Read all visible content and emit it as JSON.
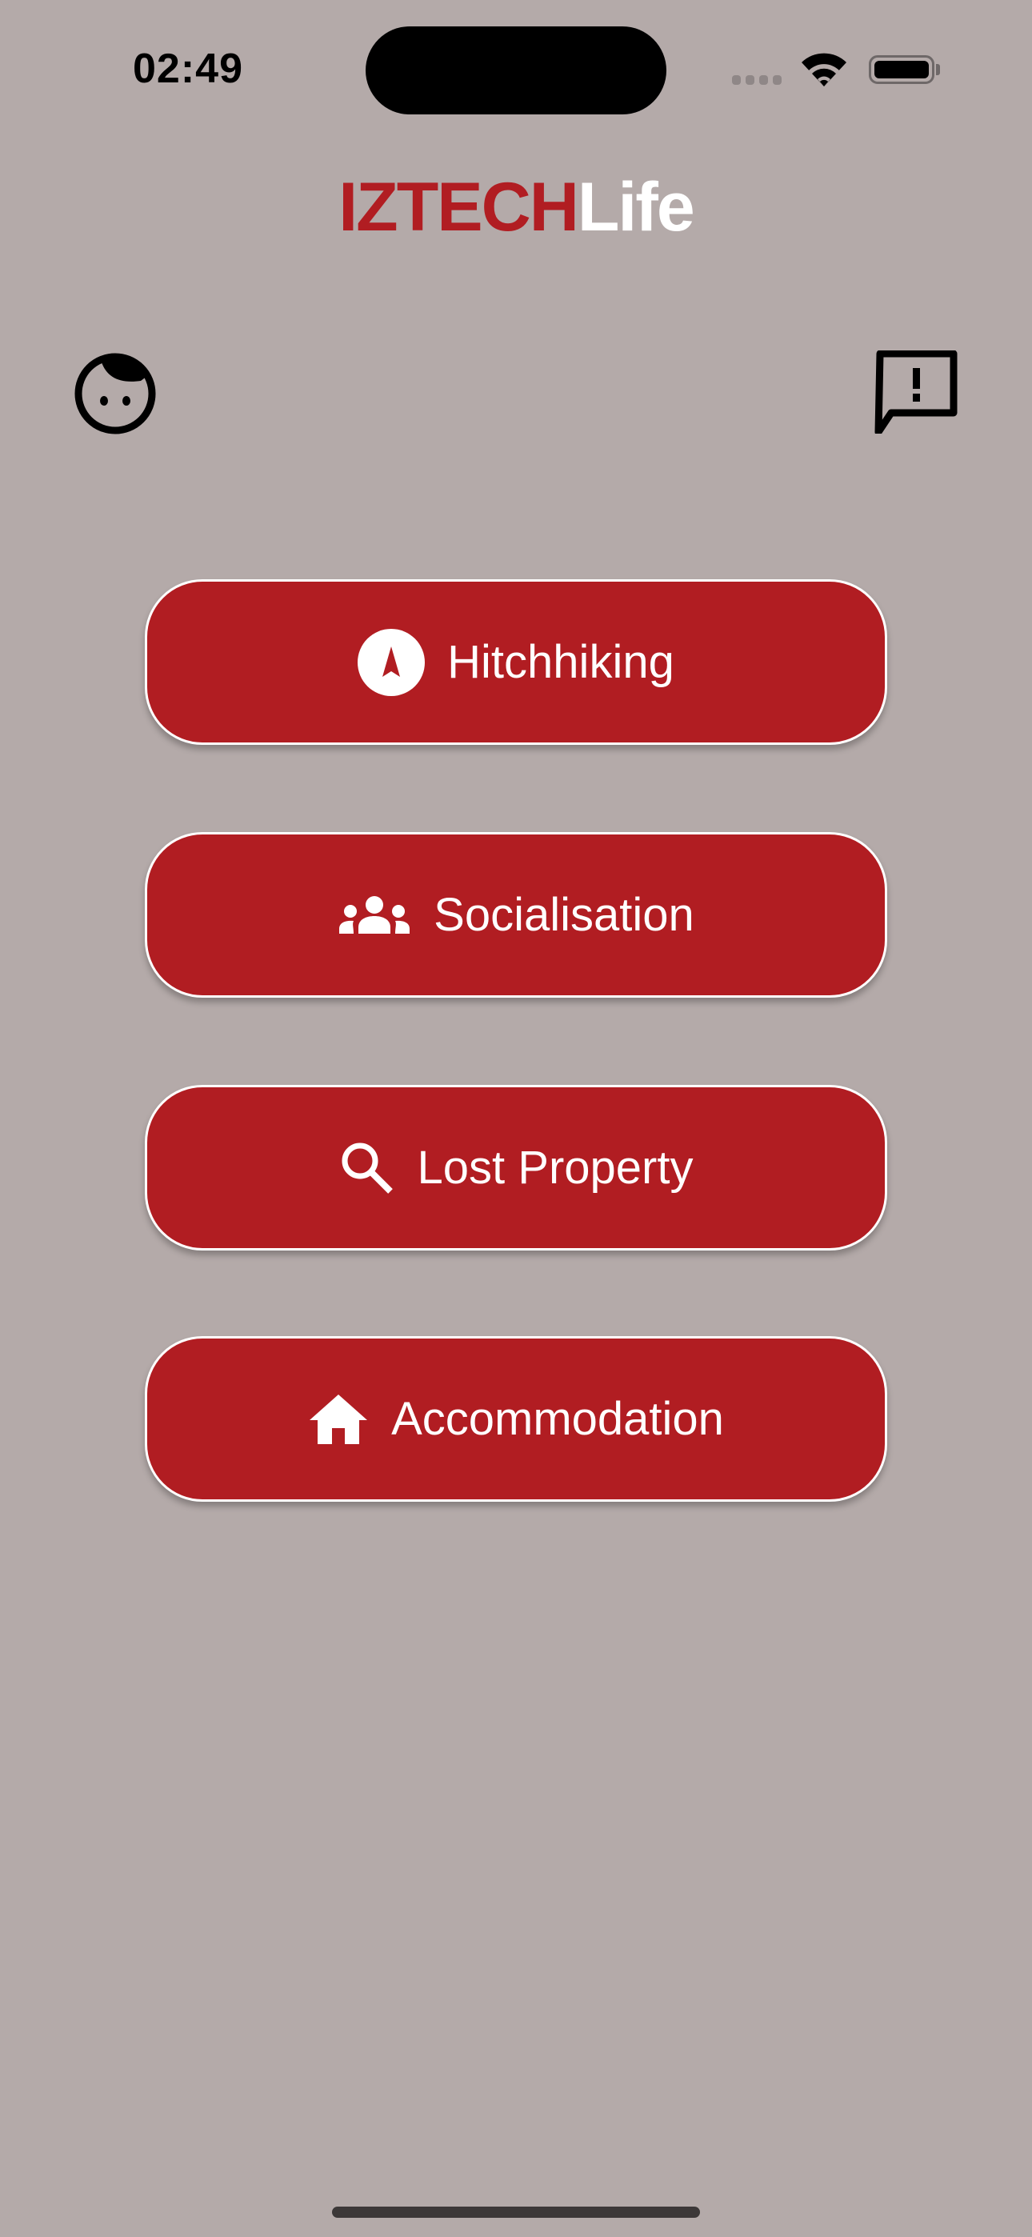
{
  "status_bar": {
    "time": "02:49",
    "signal_icon": "cellular-signal-icon",
    "wifi_icon": "wifi-icon",
    "battery_icon": "battery-icon"
  },
  "header": {
    "title_part1": "IZTECH",
    "title_part2": "Life"
  },
  "toolbar": {
    "profile_icon": "face-icon",
    "feedback_icon": "feedback-icon"
  },
  "menu": {
    "items": [
      {
        "label": "Hitchhiking",
        "icon": "navigation-icon"
      },
      {
        "label": "Socialisation",
        "icon": "groups-icon"
      },
      {
        "label": "Lost Property",
        "icon": "search-icon"
      },
      {
        "label": "Accommodation",
        "icon": "home-icon"
      }
    ]
  },
  "colors": {
    "background": "#b4aaa9",
    "accent": "#b11d22",
    "text_on_accent": "#ffffff"
  }
}
